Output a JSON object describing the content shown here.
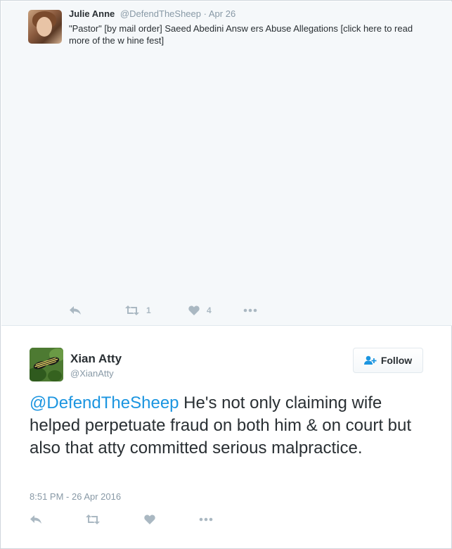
{
  "parent_tweet": {
    "name": "Julie Anne",
    "handle": "@DefendTheSheep",
    "separator": "·",
    "date": "Apr 26",
    "text": "\"Pastor\" [by mail order] Saeed Abedini Answ ers Abuse Allegations [click here to read more of the w hine fest]",
    "retweet_count": "1",
    "like_count": "4",
    "icons": [
      "reply-icon",
      "retweet-icon",
      "heart-icon",
      "more-icon"
    ]
  },
  "tweet": {
    "name": "Xian Atty",
    "handle": "@XianAtty",
    "follow_label": "Follow",
    "mention": "@DefendTheSheep",
    "text": " He's not only claiming wife helped perpetuate fraud on both him & on court but also that atty committed serious malpractice.",
    "timestamp": "8:51 PM - 26 Apr 2016",
    "icons": [
      "reply-icon",
      "retweet-icon",
      "heart-icon",
      "more-icon"
    ]
  },
  "colors": {
    "link": "#1b95e0",
    "muted": "#8899a6",
    "action_icon": "#aab8c2",
    "parent_bg": "#f5f8fa"
  }
}
